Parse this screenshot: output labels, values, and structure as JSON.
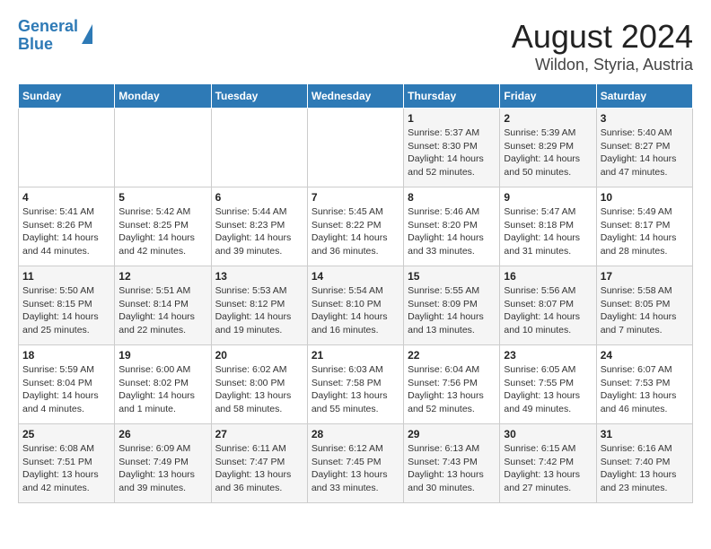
{
  "header": {
    "logo_line1": "General",
    "logo_line2": "Blue",
    "title": "August 2024",
    "subtitle": "Wildon, Styria, Austria"
  },
  "days_of_week": [
    "Sunday",
    "Monday",
    "Tuesday",
    "Wednesday",
    "Thursday",
    "Friday",
    "Saturday"
  ],
  "weeks": [
    [
      {
        "day": "",
        "info": ""
      },
      {
        "day": "",
        "info": ""
      },
      {
        "day": "",
        "info": ""
      },
      {
        "day": "",
        "info": ""
      },
      {
        "day": "1",
        "info": "Sunrise: 5:37 AM\nSunset: 8:30 PM\nDaylight: 14 hours\nand 52 minutes."
      },
      {
        "day": "2",
        "info": "Sunrise: 5:39 AM\nSunset: 8:29 PM\nDaylight: 14 hours\nand 50 minutes."
      },
      {
        "day": "3",
        "info": "Sunrise: 5:40 AM\nSunset: 8:27 PM\nDaylight: 14 hours\nand 47 minutes."
      }
    ],
    [
      {
        "day": "4",
        "info": "Sunrise: 5:41 AM\nSunset: 8:26 PM\nDaylight: 14 hours\nand 44 minutes."
      },
      {
        "day": "5",
        "info": "Sunrise: 5:42 AM\nSunset: 8:25 PM\nDaylight: 14 hours\nand 42 minutes."
      },
      {
        "day": "6",
        "info": "Sunrise: 5:44 AM\nSunset: 8:23 PM\nDaylight: 14 hours\nand 39 minutes."
      },
      {
        "day": "7",
        "info": "Sunrise: 5:45 AM\nSunset: 8:22 PM\nDaylight: 14 hours\nand 36 minutes."
      },
      {
        "day": "8",
        "info": "Sunrise: 5:46 AM\nSunset: 8:20 PM\nDaylight: 14 hours\nand 33 minutes."
      },
      {
        "day": "9",
        "info": "Sunrise: 5:47 AM\nSunset: 8:18 PM\nDaylight: 14 hours\nand 31 minutes."
      },
      {
        "day": "10",
        "info": "Sunrise: 5:49 AM\nSunset: 8:17 PM\nDaylight: 14 hours\nand 28 minutes."
      }
    ],
    [
      {
        "day": "11",
        "info": "Sunrise: 5:50 AM\nSunset: 8:15 PM\nDaylight: 14 hours\nand 25 minutes."
      },
      {
        "day": "12",
        "info": "Sunrise: 5:51 AM\nSunset: 8:14 PM\nDaylight: 14 hours\nand 22 minutes."
      },
      {
        "day": "13",
        "info": "Sunrise: 5:53 AM\nSunset: 8:12 PM\nDaylight: 14 hours\nand 19 minutes."
      },
      {
        "day": "14",
        "info": "Sunrise: 5:54 AM\nSunset: 8:10 PM\nDaylight: 14 hours\nand 16 minutes."
      },
      {
        "day": "15",
        "info": "Sunrise: 5:55 AM\nSunset: 8:09 PM\nDaylight: 14 hours\nand 13 minutes."
      },
      {
        "day": "16",
        "info": "Sunrise: 5:56 AM\nSunset: 8:07 PM\nDaylight: 14 hours\nand 10 minutes."
      },
      {
        "day": "17",
        "info": "Sunrise: 5:58 AM\nSunset: 8:05 PM\nDaylight: 14 hours\nand 7 minutes."
      }
    ],
    [
      {
        "day": "18",
        "info": "Sunrise: 5:59 AM\nSunset: 8:04 PM\nDaylight: 14 hours\nand 4 minutes."
      },
      {
        "day": "19",
        "info": "Sunrise: 6:00 AM\nSunset: 8:02 PM\nDaylight: 14 hours\nand 1 minute."
      },
      {
        "day": "20",
        "info": "Sunrise: 6:02 AM\nSunset: 8:00 PM\nDaylight: 13 hours\nand 58 minutes."
      },
      {
        "day": "21",
        "info": "Sunrise: 6:03 AM\nSunset: 7:58 PM\nDaylight: 13 hours\nand 55 minutes."
      },
      {
        "day": "22",
        "info": "Sunrise: 6:04 AM\nSunset: 7:56 PM\nDaylight: 13 hours\nand 52 minutes."
      },
      {
        "day": "23",
        "info": "Sunrise: 6:05 AM\nSunset: 7:55 PM\nDaylight: 13 hours\nand 49 minutes."
      },
      {
        "day": "24",
        "info": "Sunrise: 6:07 AM\nSunset: 7:53 PM\nDaylight: 13 hours\nand 46 minutes."
      }
    ],
    [
      {
        "day": "25",
        "info": "Sunrise: 6:08 AM\nSunset: 7:51 PM\nDaylight: 13 hours\nand 42 minutes."
      },
      {
        "day": "26",
        "info": "Sunrise: 6:09 AM\nSunset: 7:49 PM\nDaylight: 13 hours\nand 39 minutes."
      },
      {
        "day": "27",
        "info": "Sunrise: 6:11 AM\nSunset: 7:47 PM\nDaylight: 13 hours\nand 36 minutes."
      },
      {
        "day": "28",
        "info": "Sunrise: 6:12 AM\nSunset: 7:45 PM\nDaylight: 13 hours\nand 33 minutes."
      },
      {
        "day": "29",
        "info": "Sunrise: 6:13 AM\nSunset: 7:43 PM\nDaylight: 13 hours\nand 30 minutes."
      },
      {
        "day": "30",
        "info": "Sunrise: 6:15 AM\nSunset: 7:42 PM\nDaylight: 13 hours\nand 27 minutes."
      },
      {
        "day": "31",
        "info": "Sunrise: 6:16 AM\nSunset: 7:40 PM\nDaylight: 13 hours\nand 23 minutes."
      }
    ]
  ]
}
